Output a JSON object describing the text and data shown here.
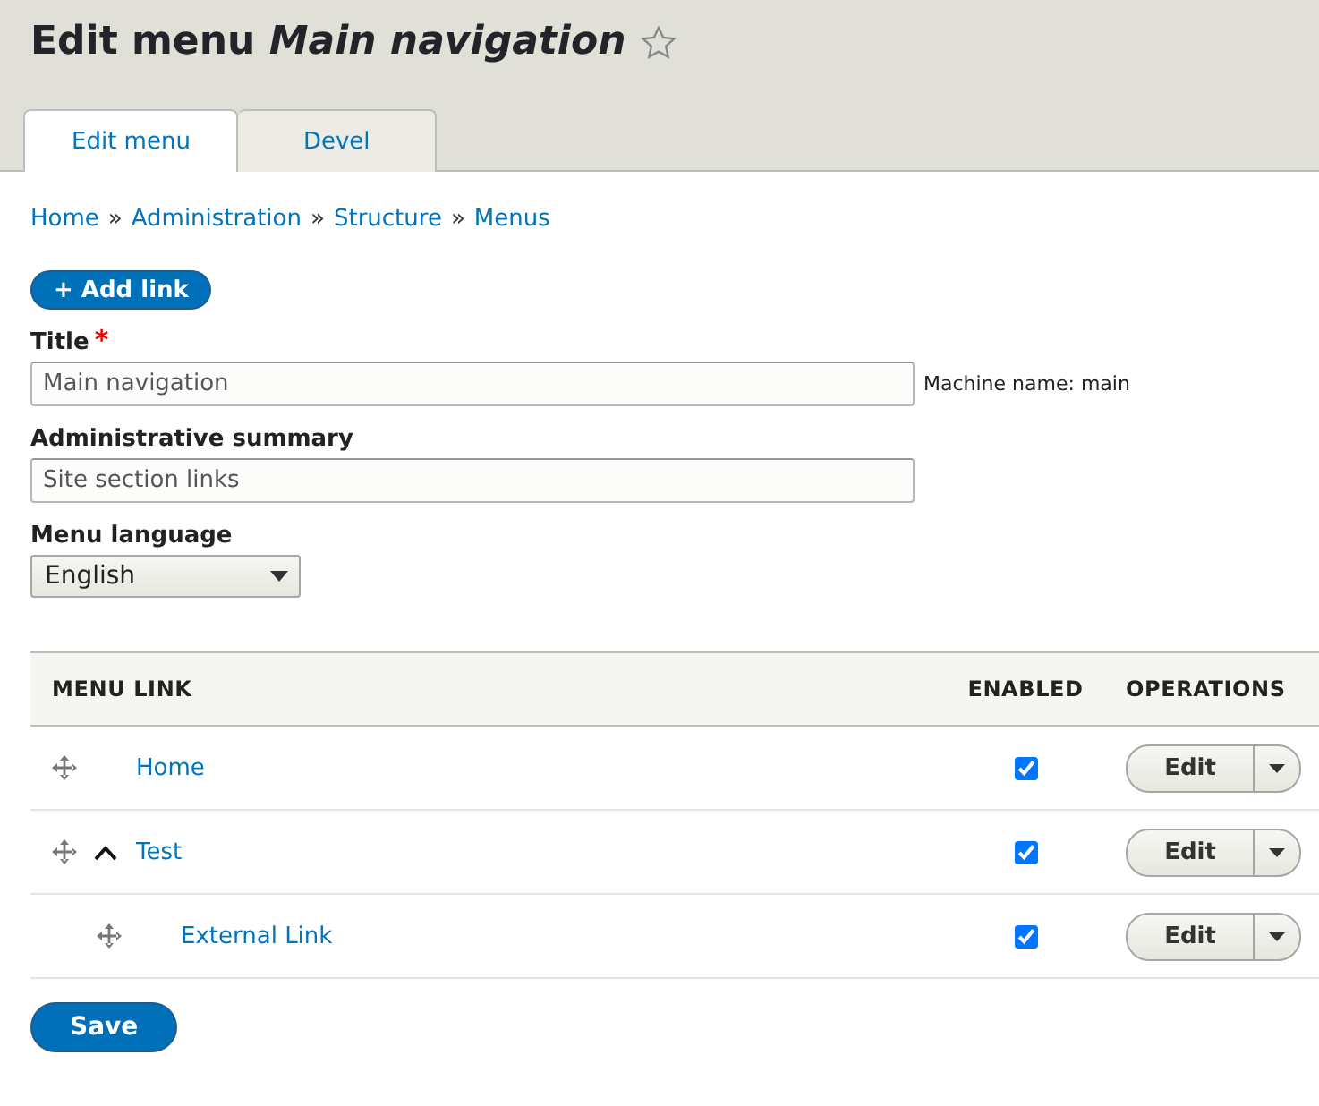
{
  "page_title": "Edit menu *Main navigation*",
  "favorite": {
    "on": false
  },
  "tabs": [
    {
      "label": "Edit menu",
      "selected": true
    },
    {
      "label": "Devel",
      "selected": false
    }
  ],
  "breadcrumb": {
    "separator": "»",
    "links": [
      "Home",
      "Administration",
      "Structure",
      "Menus"
    ]
  },
  "add_link_button": "+ Add link",
  "title_field": {
    "label": "Title",
    "required": true,
    "required_mark": "*",
    "value": "Main navigation",
    "machine_name": "Machine name: main"
  },
  "summary_field": {
    "label": "Administrative summary",
    "value": "Site section links"
  },
  "language_field": {
    "label": "Menu language",
    "value": "English"
  },
  "table": {
    "columns": [
      "MENU LINK",
      "ENABLED",
      "OPERATIONS"
    ],
    "items": [
      {
        "title": "Home",
        "enabled": true,
        "operation": "Edit"
      },
      {
        "title": "Test",
        "enabled": true,
        "operation": "Edit",
        "expanded": true,
        "children": [
          {
            "title": "External Link",
            "enabled": true,
            "operation": "Edit"
          }
        ]
      }
    ]
  },
  "save_button": "Save"
}
